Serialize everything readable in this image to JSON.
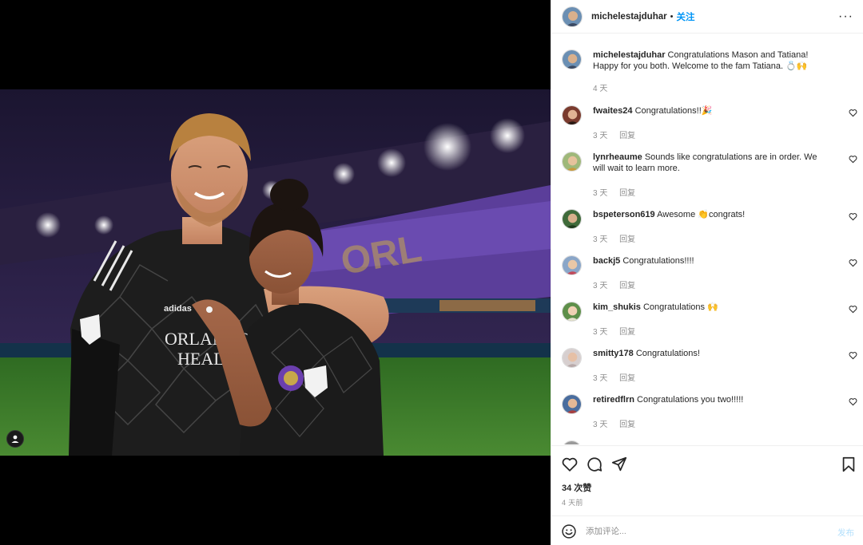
{
  "post": {
    "author": "michelestajduhar",
    "separator": "•",
    "follow_label": "关注",
    "more_label": "···"
  },
  "caption": {
    "username": "michelestajduhar",
    "text": "Congratulations Mason and Tatiana! Happy for you both. Welcome to the fam Tatiana. 💍🙌",
    "time": "4 天"
  },
  "comments": [
    {
      "username": "fwaites24",
      "text": "Congratulations!!🎉",
      "time": "3 天",
      "reply": "回复"
    },
    {
      "username": "lynrheaume",
      "text": "Sounds like congratulations are in order. We will wait to learn more.",
      "time": "3 天",
      "reply": "回复"
    },
    {
      "username": "bspeterson619",
      "text": "Awesome 👏congrats!",
      "time": "3 天",
      "reply": "回复"
    },
    {
      "username": "backj5",
      "text": "Congratulations!!!!",
      "time": "3 天",
      "reply": "回复"
    },
    {
      "username": "kim_shukis",
      "text": "Congratulations 🙌",
      "time": "3 天",
      "reply": "回复"
    },
    {
      "username": "smitty178",
      "text": "Congratulations!",
      "time": "3 天",
      "reply": "回复"
    },
    {
      "username": "retiredflrn",
      "text": "Congratulations you two!!!!!",
      "time": "3 天",
      "reply": "回复"
    }
  ],
  "stats": {
    "likes": "34 次赞",
    "date": "4 天前"
  },
  "composer": {
    "placeholder": "添加评论...",
    "post_label": "发布"
  },
  "photo": {
    "jersey_text_line1": "ORLANDO",
    "jersey_text_line2": "HEALTH",
    "sleeve_logo": "adidas"
  },
  "colors": {
    "link": "#0095f6",
    "muted": "#8e8e8e",
    "post_disabled": "#b2dffc",
    "pitch_green": "#3f7c2d",
    "purple_stands": "#5b3e9a"
  }
}
